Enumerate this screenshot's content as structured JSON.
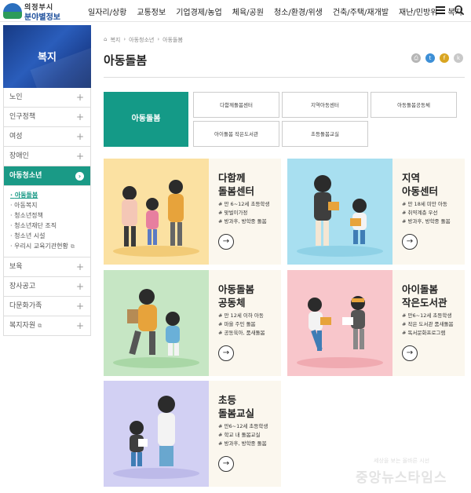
{
  "logo": {
    "line1": "의정부시",
    "line2": "분야별정보"
  },
  "gnb": [
    "일자리/상황",
    "교통정보",
    "기업경제/농업",
    "체육/공원",
    "청소/환경/위생",
    "건축/주택/재개발",
    "재난/민방위",
    "복지"
  ],
  "icons": {
    "menu": "hamburger-icon",
    "search": "search-icon"
  },
  "sidebar": {
    "title": "복지",
    "items": [
      "노인",
      "인구정책",
      "여성",
      "장애인"
    ],
    "active": "아동청소년",
    "sub": [
      "아동돌봄",
      "아동복지",
      "청소년정책",
      "청소년재단 조직",
      "청소년 시설",
      "우리시 교육기관현황"
    ],
    "items_after": [
      "보육",
      "장사공고",
      "다문화가족",
      "복지자원"
    ]
  },
  "breadcrumb": [
    "복지",
    "아동청소년",
    "아동돌봄"
  ],
  "page_title": "아동돌봄",
  "share": [
    "print",
    "twitter",
    "facebook",
    "kakao"
  ],
  "categories": {
    "main": "아동돌봄",
    "buttons": [
      "다함께돌봄센터",
      "지역아동센터",
      "아동돌봄공동체",
      "아이돌봄 작은도서관",
      "초등돌봄교실"
    ]
  },
  "cards": [
    {
      "title": [
        "다함께",
        "돌봄센터"
      ],
      "features": [
        "# 만 6~12세 초등학생",
        "# 맞벌이가정",
        "# 방과후, 방학중 돌봄"
      ],
      "bg": "#fbe1a2"
    },
    {
      "title": [
        "지역",
        "아동센터"
      ],
      "features": [
        "# 만 18세 미만 아동",
        "# 취약계층 우선",
        "# 방과후, 방학중 돌봄"
      ],
      "bg": "#a8dff0"
    },
    {
      "title": [
        "아동돌봄",
        "공동체"
      ],
      "features": [
        "# 만 12세 이하 아동",
        "# 마을 주민 돌봄",
        "# 공동육아, 품새돌봄"
      ],
      "bg": "#c6e6c4"
    },
    {
      "title": [
        "아이돌봄",
        "작은도서관"
      ],
      "features": [
        "# 만6~12세 초등학생",
        "# 작은 도서관 품새돌봄",
        "# 독서문화프로그램"
      ],
      "bg": "#f8c6cb"
    },
    {
      "title": [
        "초등",
        "돌봄교실"
      ],
      "features": [
        "# 만6~12세 초등학생",
        "# 학교 내 돌봄교실",
        "# 방과후, 방학중 돌봄"
      ],
      "bg": "#d2d0f3"
    }
  ],
  "watermark": {
    "small": "세상을 보는 올바른 시선",
    "big": "중앙뉴스타임스"
  }
}
